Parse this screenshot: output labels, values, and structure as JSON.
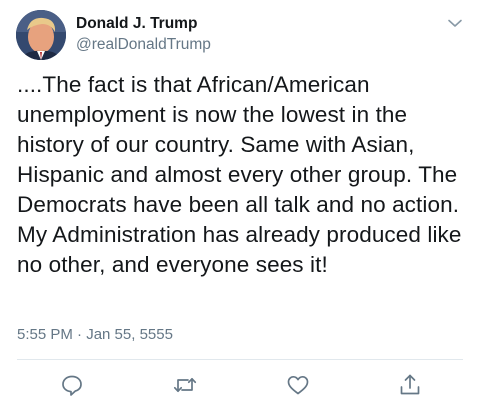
{
  "author": {
    "display_name": "Donald J. Trump",
    "handle": "@realDonaldTrump",
    "avatar_icon": "profile-photo"
  },
  "tweet": {
    "text": "....The fact is that African/American unemployment is now the lowest in the history of our country. Same with Asian, Hispanic and almost every other group. The Democrats have been all talk and no action. My Administration has already produced like no other, and everyone sees it!",
    "timestamp": "5:55 PM · Jan 55, 5555"
  },
  "menu": {
    "icon": "chevron-down-icon"
  },
  "actions": [
    {
      "name": "reply",
      "icon": "reply-icon"
    },
    {
      "name": "retweet",
      "icon": "retweet-icon"
    },
    {
      "name": "like",
      "icon": "heart-icon"
    },
    {
      "name": "share",
      "icon": "share-icon"
    }
  ],
  "colors": {
    "text_primary": "#14171a",
    "text_secondary": "#657786",
    "divider": "#e1e8ed",
    "background": "#ffffff"
  }
}
